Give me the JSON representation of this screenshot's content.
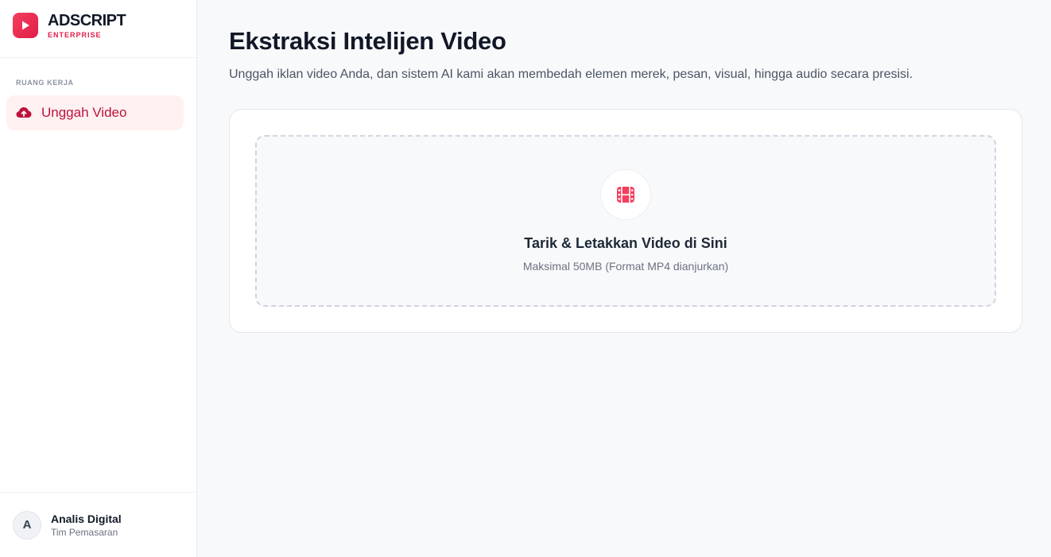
{
  "brand": {
    "name": "ADSCRIPT",
    "subtitle": "ENTERPRISE",
    "logo_icon": "play-icon"
  },
  "sidebar": {
    "section_label": "RUANG KERJA",
    "items": [
      {
        "label": "Unggah Video",
        "icon": "cloud-upload-icon",
        "active": true
      }
    ]
  },
  "user": {
    "initial": "A",
    "name": "Analis Digital",
    "role": "Tim Pemasaran"
  },
  "main": {
    "title": "Ekstraksi Intelijen Video",
    "description": "Unggah iklan video Anda, dan sistem AI kami akan membedah elemen merek, pesan, visual, hingga audio secara presisi."
  },
  "dropzone": {
    "icon": "film-icon",
    "title": "Tarik & Letakkan Video di Sini",
    "hint": "Maksimal 50MB (Format MP4 dianjurkan)"
  },
  "colors": {
    "accent": "#e11d48",
    "accent_soft": "#fff1f2",
    "background": "#f8f9fb"
  }
}
